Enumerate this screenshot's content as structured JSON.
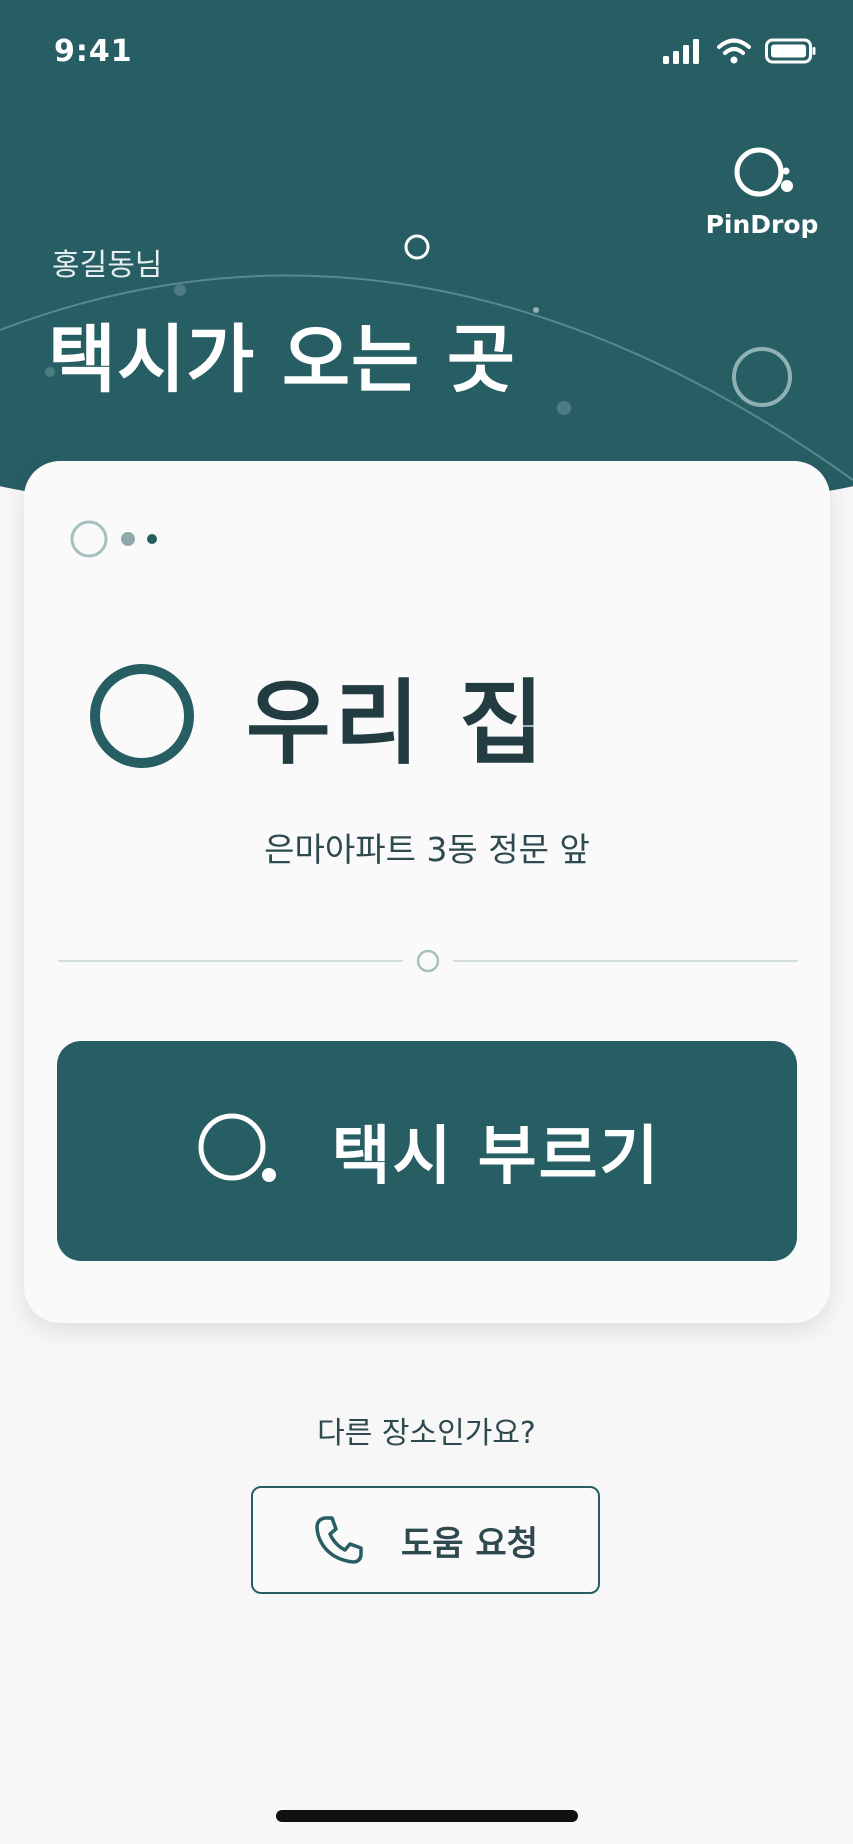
{
  "status_bar": {
    "time": "9:41",
    "icons": [
      "signal-icon",
      "wifi-icon",
      "battery-icon"
    ]
  },
  "brand": {
    "name": "PinDrop",
    "icon": "pin-circle-icon"
  },
  "header": {
    "greeting": "홍길동님",
    "title": "택시가 오는 곳"
  },
  "card": {
    "pager_icon": "carousel-dots-icon",
    "place_icon": "place-ring-icon",
    "place_name": "우리 집",
    "place_description": "은마아파트 3동 정문 앞",
    "call_button": {
      "label": "택시 부르기",
      "icon": "pin-circle-icon"
    }
  },
  "footer": {
    "question": "다른 장소인가요?",
    "help_button": {
      "label": "도움 요청",
      "icon": "phone-icon"
    }
  },
  "colors": {
    "primary": "#275e64",
    "background": "#f7f7f7",
    "card": "#fafafa",
    "text_dark": "#223c42"
  }
}
